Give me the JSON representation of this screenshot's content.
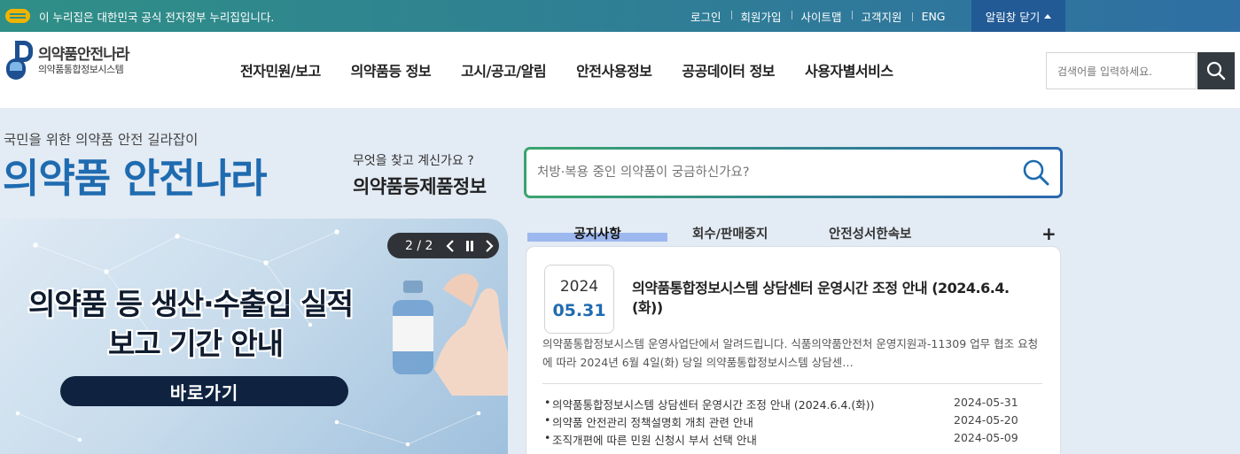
{
  "gov_bar": {
    "notice": "이 누리집은 대한민국 공식 전자정부 누리집입니다.",
    "util_links": [
      "로그인",
      "회원가입",
      "사이트맵",
      "고객지원",
      "ENG"
    ],
    "close_alert": "알림창 닫기"
  },
  "header": {
    "logo_title": "의약품안전나라",
    "logo_subtitle": "의약품통합정보시스템",
    "nav": [
      "전자민원/보고",
      "의약품등 정보",
      "고시/공고/알림",
      "안전사용정보",
      "공공데이터 정보",
      "사용자별서비스"
    ],
    "search_placeholder": "검색어를 입력하세요."
  },
  "hero": {
    "tagline": "국민을 위한 의약품 안전 길라잡이",
    "brand": "의약품 안전나라",
    "question": "무엇을 찾고 계신가요 ?",
    "category": "의약품등제품정보",
    "search_placeholder": "처방·복용 중인 의약품이 궁금하신가요?"
  },
  "banner": {
    "title_line1": "의약품 등 생산·수출입 실적",
    "title_line2": "보고 기간 안내",
    "button": "바로가기",
    "page_current": "2",
    "page_total": "2"
  },
  "notices": {
    "tabs": [
      "공지사항",
      "회수/판매중지",
      "안전성서한속보"
    ],
    "more": "+",
    "featured": {
      "year": "2024",
      "monthday": "05.31",
      "title": "의약품통합정보시스템 상담센터 운영시간 조정 안내 (2024.6.4.(화))",
      "desc": "의약품통합정보시스템 운영사업단에서 알려드립니다.  식품의약품안전처 운영지원과-11309 업무 협조 요청에 따라 2024년 6월 4일(화) 당일 의약품통합정보시스템 상담센…"
    },
    "list": [
      {
        "title": "의약품통합정보시스템 상담센터 운영시간 조정 안내 (2024.6.4.(화))",
        "date": "2024-05-31"
      },
      {
        "title": "의약품 안전관리 정책설명회 개최 관련 안내",
        "date": "2024-05-20"
      },
      {
        "title": "조직개편에 따른 민원 신청시 부서 선택 안내",
        "date": "2024-05-09"
      }
    ]
  },
  "colors": {
    "brand_blue": "#1f6bb0",
    "gov_bar_start": "#2f8f86",
    "gov_bar_end": "#2f6fa3",
    "dark_button": "#333a40",
    "tab_highlight": "#9db8ef"
  }
}
